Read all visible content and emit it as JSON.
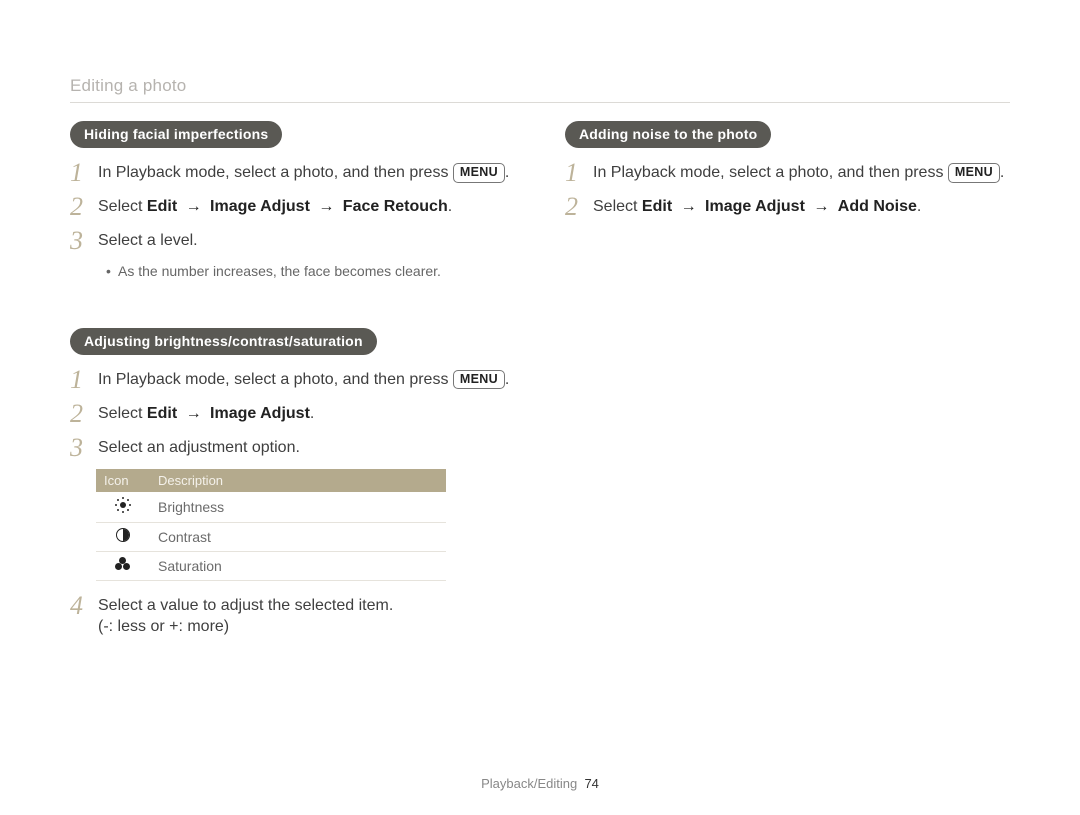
{
  "header": {
    "title": "Editing a photo"
  },
  "left": {
    "section1": {
      "pill": "Hiding facial imperfections",
      "steps": {
        "s1": {
          "num": "1",
          "text_a": "In Playback mode, select a photo, and then press ",
          "menu": "MENU",
          "text_b": "."
        },
        "s2": {
          "num": "2",
          "prefix": "Select ",
          "e": "Edit",
          "arr1": " → ",
          "ia": "Image Adjust",
          "arr2": " → ",
          "fr": "Face Retouch",
          "suffix": "."
        },
        "s3": {
          "num": "3",
          "text": "Select a level."
        },
        "s3_note": "As the number increases, the face becomes clearer."
      }
    },
    "section2": {
      "pill": "Adjusting brightness/contrast/saturation",
      "steps": {
        "s1": {
          "num": "1",
          "text_a": "In Playback mode, select a photo, and then press ",
          "menu": "MENU",
          "text_b": "."
        },
        "s2": {
          "num": "2",
          "prefix": "Select ",
          "e": "Edit",
          "arr1": " → ",
          "ia": "Image Adjust",
          "suffix": "."
        },
        "s3": {
          "num": "3",
          "text": "Select an adjustment option."
        },
        "s4": {
          "num": "4",
          "line1": "Select a value to adjust the selected item.",
          "line2": "(-: less or +: more)"
        }
      },
      "table": {
        "head_icon": "Icon",
        "head_desc": "Description",
        "rows": {
          "r0": "Brightness",
          "r1": "Contrast",
          "r2": "Saturation"
        }
      }
    }
  },
  "right": {
    "section1": {
      "pill": "Adding noise to the photo",
      "steps": {
        "s1": {
          "num": "1",
          "text_a": "In Playback mode, select a photo, and then press ",
          "menu": "MENU",
          "text_b": "."
        },
        "s2": {
          "num": "2",
          "prefix": "Select ",
          "e": "Edit",
          "arr1": " → ",
          "ia": "Image Adjust",
          "arr2": " → ",
          "an": "Add Noise",
          "suffix": "."
        }
      }
    }
  },
  "footer": {
    "section": "Playback/Editing",
    "page": "74"
  }
}
